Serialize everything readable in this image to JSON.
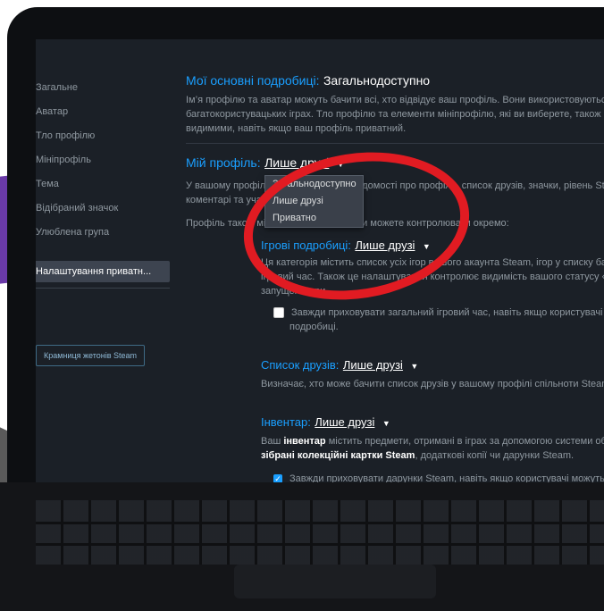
{
  "sidebar": {
    "items": [
      {
        "label": "Загальне"
      },
      {
        "label": "Аватар"
      },
      {
        "label": "Тло профілю"
      },
      {
        "label": "Мініпрофіль"
      },
      {
        "label": "Тема"
      },
      {
        "label": "Відібраний значок"
      },
      {
        "label": "Улюблена група"
      },
      {
        "label": "Налаштування приватн..."
      }
    ],
    "badge_shop": "Крамниця жетонів Steam"
  },
  "main": {
    "basics": {
      "title": "Мої основні подробиці:",
      "value": "Загальнодоступно",
      "desc_line1": "Ім’я профілю та аватар можуть бачити всі, хто відвідує ваш профіль. Вони використовуються в",
      "desc_line2": "багатокористувацьких іграх. Тло профілю та елементи мініпрофілю, які ви виберете, також можуть бути",
      "desc_line3": "видимими, навіть якщо ваш профіль приватний."
    },
    "profile": {
      "title": "Мій профіль:",
      "value": "Лише друзі",
      "desc_line1": "У вашому профілі міститься коротка відомості про профіль, список друзів, значки, рівень Steam,",
      "desc_line2": "коментарі та участь у спільнотах.",
      "desc_line3": "Профіль також містить елементи, які ви можете контролювати окремо:"
    },
    "dropdown": {
      "options": [
        {
          "label": "Загальнодоступно"
        },
        {
          "label": "Лише друзі"
        },
        {
          "label": "Приватно"
        }
      ]
    },
    "game_details": {
      "title": "Ігрові подробиці:",
      "value": "Лише друзі",
      "desc_line1": "Ця категорія містить список усіх ігор вашого акаунта Steam, ігор у списку бажаного, досягнення та",
      "desc_line2": "ігровий час. Також це налаштування контролює видимість вашого статусу «У грі» та назви",
      "desc_line3": "запущеної гри.",
      "checkbox_line1": "Завжди приховувати загальний ігровий час, навіть якщо користувачі можуть бачити ваші ігрові",
      "checkbox_line2": "подробиці."
    },
    "friends_list": {
      "title": "Список друзів:",
      "value": "Лише друзі",
      "desc_line1": "Визначає, хто може бачити список друзів у вашому профілі спільноти Steam."
    },
    "inventory": {
      "title": "Інвентар:",
      "value": "Лише друзі",
      "desc_line1_pre": "Ваш ",
      "desc_line1_bold": "інвентар",
      "desc_line1_post": " містить предмети, отримані в іграх за допомогою системи обміну Steam.",
      "desc_line2_bold": "зібрані колекційні картки Steam",
      "desc_line2_post": ", додаткові копії чи дарунки Steam.",
      "checkbox_label": "Завжди приховувати дарунки Steam, навіть якщо користувачі можуть бачити ваш інвентар"
    }
  },
  "colors": {
    "accent": "#1a9fff",
    "annotation": "#e11b22",
    "panel": "#1b2027"
  }
}
